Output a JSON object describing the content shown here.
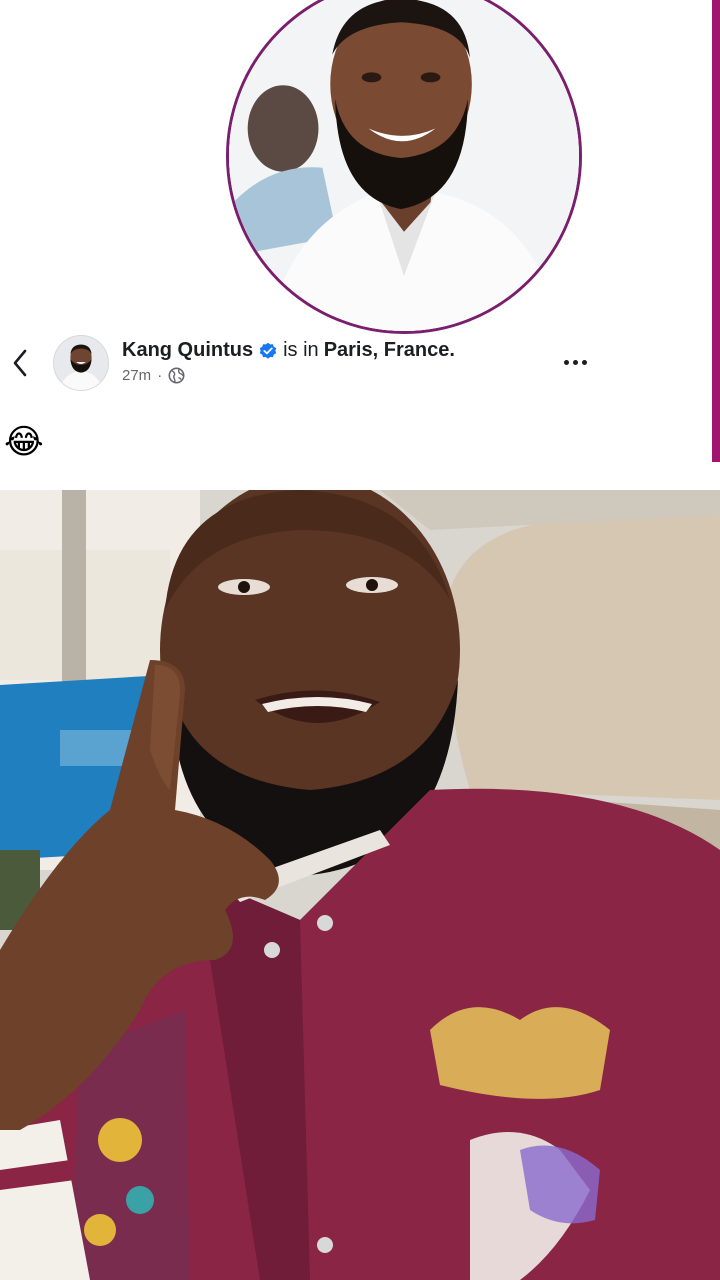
{
  "post": {
    "author": "Kang Quintus",
    "status_prefix": "is in",
    "location": "Paris, France.",
    "time": "27m",
    "separator": "·",
    "audience_icon": "globe-icon",
    "verified_icon": "verified-badge-icon",
    "back_icon": "chevron-left-icon",
    "more_icon": "more-horizontal-icon",
    "body_emoji": "😂"
  },
  "colors": {
    "accent": "#a0156e",
    "photo_ring": "#7a1f6e",
    "verified": "#1877f2",
    "text_primary": "#1c1e21",
    "text_secondary": "#65676b",
    "jacket": "#8a2546"
  }
}
